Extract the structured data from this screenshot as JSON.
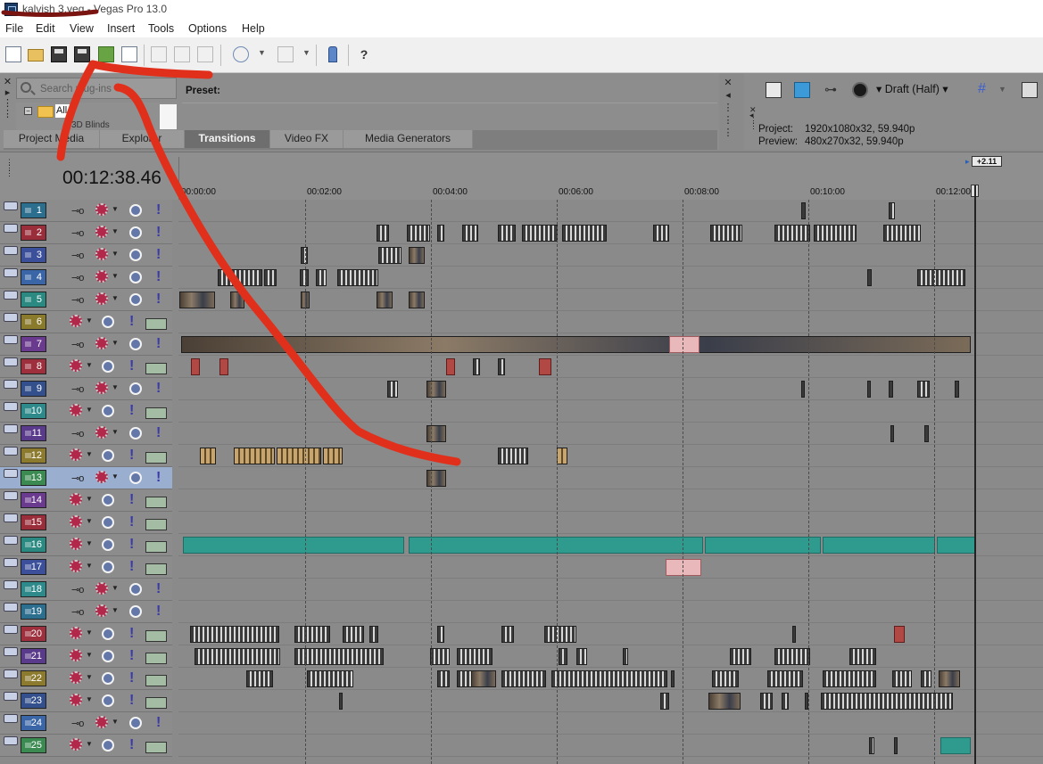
{
  "window": {
    "title": "kalvish 3.veg - Vegas Pro 13.0"
  },
  "menu": [
    "File",
    "Edit",
    "View",
    "Insert",
    "Tools",
    "Options",
    "Help"
  ],
  "toolbar": {
    "icons": [
      "new-project-icon",
      "open-icon",
      "save-icon",
      "save-as-icon",
      "render-icon",
      "properties-icon",
      "cut-icon",
      "copy-icon",
      "paste-icon",
      "undo-icon",
      "redo-icon",
      "cleanup-brush-icon",
      "whats-this-help-icon"
    ]
  },
  "explorer": {
    "search_placeholder": "Search plug-ins",
    "tree_all_label": "All",
    "tree_item": "3D Blinds",
    "preset_label": "Preset:",
    "tabs": [
      "Project Media",
      "Explorer",
      "Transitions",
      "Video FX",
      "Media Generators"
    ],
    "active_tab": "Transitions"
  },
  "preview": {
    "quality": "Draft (Half)",
    "project_label": "Project:",
    "project_value": "1920x1080x32, 59.940p",
    "preview_label": "Preview:",
    "preview_value": "480x270x32, 59.940p"
  },
  "timeline": {
    "timecode": "00:12:38.46",
    "rate_badge": "+2.11",
    "ruler_labels": [
      "00:00:00",
      "00:02:00",
      "00:04:00",
      "00:06:00",
      "00:08:00",
      "00:10:00",
      "00:12:00"
    ],
    "tracks": [
      {
        "num": "1",
        "type": "video",
        "color": "#2c6e8e"
      },
      {
        "num": "2",
        "type": "video",
        "color": "#9a2d3a"
      },
      {
        "num": "3",
        "type": "video",
        "color": "#3b4f9a"
      },
      {
        "num": "4",
        "type": "video",
        "color": "#3a66a8"
      },
      {
        "num": "5",
        "type": "video",
        "color": "#2a8a82"
      },
      {
        "num": "6",
        "type": "audio",
        "color": "#8a7a2c"
      },
      {
        "num": "7",
        "type": "video",
        "color": "#6a3a8e"
      },
      {
        "num": "8",
        "type": "audio",
        "color": "#9e2f3d"
      },
      {
        "num": "9",
        "type": "video",
        "color": "#33508c"
      },
      {
        "num": "10",
        "type": "audio",
        "color": "#2e8a8a"
      },
      {
        "num": "11",
        "type": "video",
        "color": "#5a3a8a"
      },
      {
        "num": "12",
        "type": "audio",
        "color": "#8c7a2f"
      },
      {
        "num": "13",
        "type": "video",
        "color": "#3a8a52"
      },
      {
        "num": "14",
        "type": "audio",
        "color": "#6a3a8e"
      },
      {
        "num": "15",
        "type": "audio",
        "color": "#9a2d3a"
      },
      {
        "num": "16",
        "type": "audio",
        "color": "#2a8a82"
      },
      {
        "num": "17",
        "type": "audio",
        "color": "#3b4f9a"
      },
      {
        "num": "18",
        "type": "video",
        "color": "#2e8a8a"
      },
      {
        "num": "19",
        "type": "video",
        "color": "#2c6e8e"
      },
      {
        "num": "20",
        "type": "audio",
        "color": "#9e2f3d"
      },
      {
        "num": "21",
        "type": "audio",
        "color": "#5a3a8a"
      },
      {
        "num": "22",
        "type": "audio",
        "color": "#8c7a2f"
      },
      {
        "num": "23",
        "type": "audio",
        "color": "#33508c"
      },
      {
        "num": "24",
        "type": "video",
        "color": "#3a66a8"
      },
      {
        "num": "25",
        "type": "audio",
        "color": "#3a8a52"
      }
    ],
    "selected_track": "13"
  },
  "colors": {
    "annotation_red": "#e0301c",
    "title_scribble": "#7a1410"
  }
}
